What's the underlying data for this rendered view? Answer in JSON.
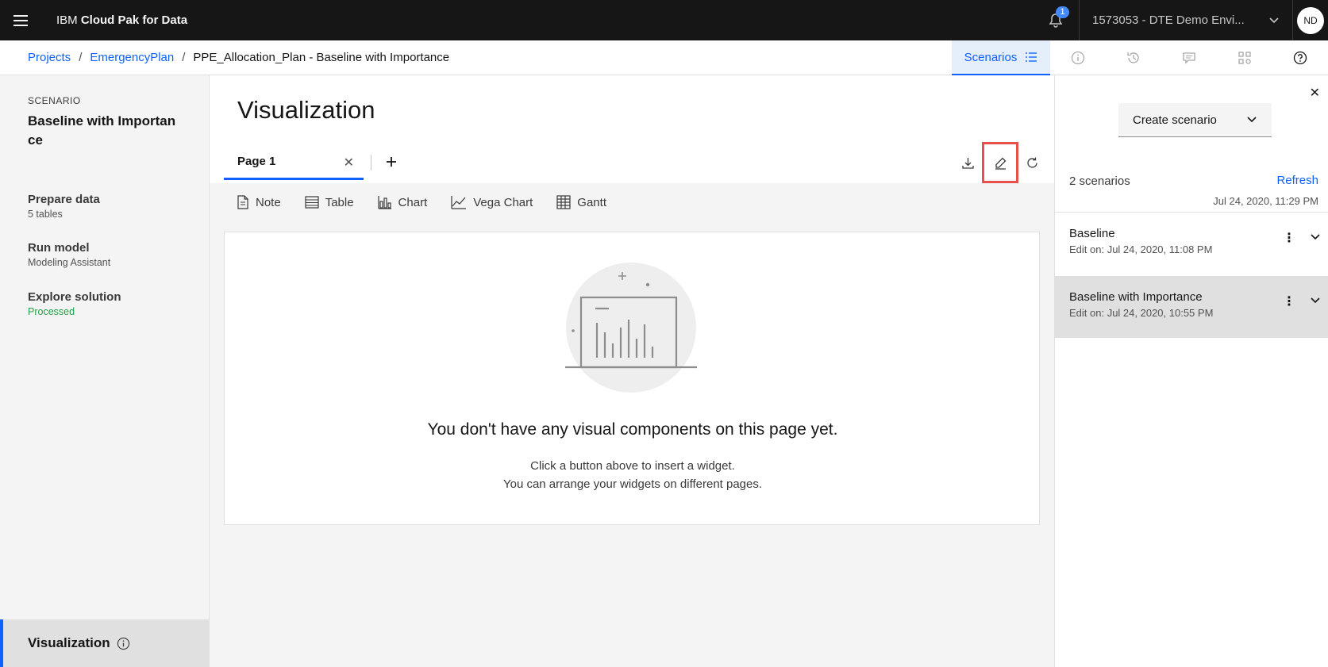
{
  "header": {
    "brand_prefix": "IBM",
    "brand_name": "Cloud Pak for Data",
    "notification_count": "1",
    "account": "1573053 - DTE Demo Envi...",
    "avatar_initials": "ND"
  },
  "breadcrumb": {
    "items": [
      "Projects",
      "EmergencyPlan"
    ],
    "current": "PPE_Allocation_Plan - Baseline with Importance",
    "separator": "/"
  },
  "toolbar": {
    "scenarios_label": "Scenarios"
  },
  "sidebar": {
    "scenario_label": "SCENARIO",
    "scenario_name": "Baseline with Importan ce",
    "steps": [
      {
        "title": "Prepare data",
        "subtitle": "5 tables"
      },
      {
        "title": "Run model",
        "subtitle": "Modeling Assistant"
      },
      {
        "title": "Explore solution",
        "subtitle": "Processed"
      }
    ],
    "active_item": "Visualization"
  },
  "main": {
    "title": "Visualization",
    "tab_label": "Page 1",
    "widgets": [
      "Note",
      "Table",
      "Chart",
      "Vega Chart",
      "Gantt"
    ],
    "empty_title": "You don't have any visual components on this page yet.",
    "empty_line1": "Click a button above to insert a widget.",
    "empty_line2": "You can arrange your widgets on different pages."
  },
  "panel": {
    "create_label": "Create scenario",
    "count_label": "2 scenarios",
    "refresh_label": "Refresh",
    "timestamp": "Jul 24, 2020, 11:29 PM",
    "scenarios": [
      {
        "name": "Baseline",
        "edited": "Edit on: Jul 24, 2020, 11:08 PM"
      },
      {
        "name": "Baseline with Importance",
        "edited": "Edit on: Jul 24, 2020, 10:55 PM"
      }
    ]
  },
  "colors": {
    "accent": "#0f62fe",
    "highlight": "#e8504a",
    "success": "#24a148"
  }
}
